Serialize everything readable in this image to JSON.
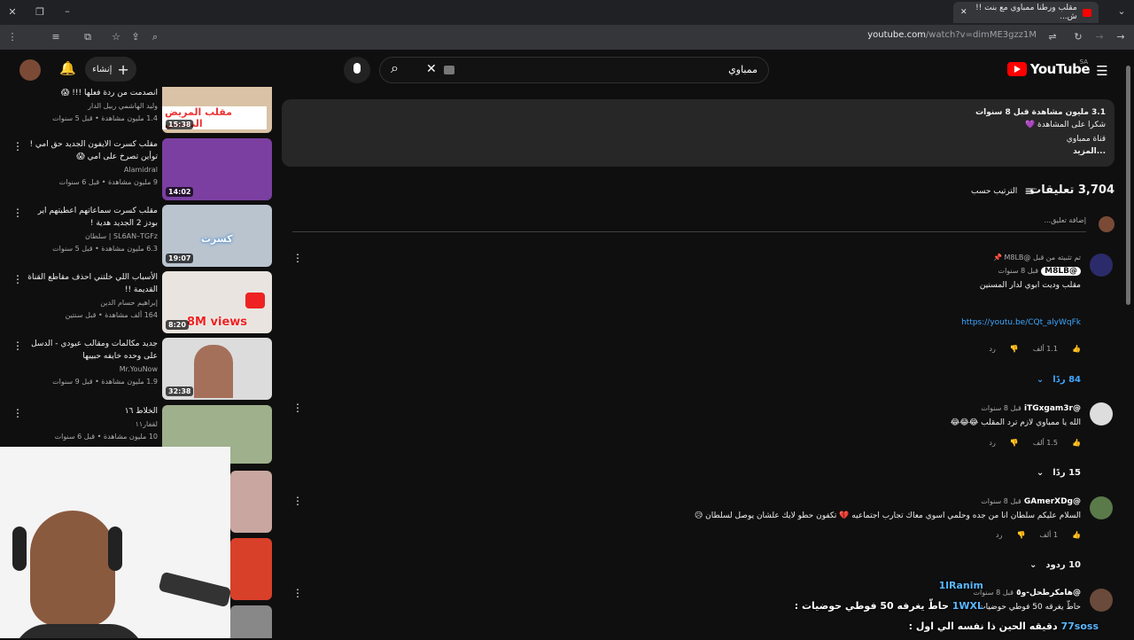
{
  "browser": {
    "tab_title": "مقلب ورطنا ممباوي مع بنت !! ش...",
    "url_host": "youtube.com",
    "url_path": "/watch?v=dimME3gzz1M"
  },
  "header": {
    "logo_text": "YouTube",
    "region": "SA",
    "search_query": "ممباوي",
    "create_label": "إنشاء"
  },
  "sidebar_videos": [
    {
      "title": "انصدمت من ردة فعلها !!! 😱",
      "channel": "وليد الهاشمي ربيل الدار",
      "meta": "1.4 مليون مشاهدة • قبل 5 سنوات",
      "duration": "15:38",
      "thumb_text": "مقلب المريض النفسي",
      "thumb_color": "#d9c2a5"
    },
    {
      "title": "مقلب كسرت الايفون الجديد حق امي ! توأين تصرخ على امي 😱",
      "channel": "Alamidral",
      "meta": "9 مليون مشاهدة • قبل 6 سنوات",
      "duration": "14:02",
      "thumb_text": "",
      "thumb_color": "#7a3fa0"
    },
    {
      "title": "مقلب كسرت سماعاتهم اعطيتهم اير بودز 2 الجديد هدية !",
      "channel": "SL6AN–TGFz | سلطان",
      "meta": "6.3 مليون مشاهدة • قبل 5 سنوات",
      "duration": "19:07",
      "thumb_text": "كسرت",
      "thumb_color": "#b9c4cf"
    },
    {
      "title": "الأسباب اللي خلتني احذف مقاطع القناة القديمة !!",
      "channel": "إبراهيم حسام الدين",
      "meta": "164 ألف مشاهدة • قبل سنتين",
      "duration": "8:20",
      "thumb_text": "8M views",
      "thumb_color": "#e9e4df"
    },
    {
      "title": "جديد مكالمات ومقالب عبودي - الدسل على وحده خايفه حبيبها",
      "channel": "Mr.YouNow",
      "meta": "1.9 مليون مشاهدة • قبل 9 سنوات",
      "duration": "32:38",
      "thumb_text": "",
      "thumb_color": "#dcdcdc"
    },
    {
      "title": "الخلاط ١٦",
      "channel": "لقفار١١",
      "meta": "10 مليون مشاهدة • قبل 6 سنوات",
      "duration": "",
      "thumb_text": "",
      "thumb_color": "#9fb08c"
    }
  ],
  "description": {
    "stats": "3.1 مليون مشاهدة  قبل 8 سنوات",
    "line1": "شكرا على المشاهدة 💜",
    "line2": "قناة ممباوي",
    "more": "...المزيد"
  },
  "comments_header": {
    "count": "3,704 تعليقات",
    "sort_label": "الترتيب حسب",
    "add_placeholder": "إضافة تعليق..."
  },
  "comments": [
    {
      "pinned_note": "تم تثبيته من قبل @M8LB",
      "author": "@M8LB",
      "time": "قبل 8 سنوات",
      "text": "مقلب وديت ابوي لدار المسنين",
      "link": "https://youtu.be/CQt_alyWqFk",
      "likes": "1.1 ألف",
      "reply_label": "رد",
      "replies": "84 ردًا"
    },
    {
      "author": "@iTGxgam3r",
      "time": "قبل 8 سنوات",
      "text": "الله يا ممباوي لازم ترد المقلب 😂😂😂",
      "likes": "1.5 ألف",
      "reply_label": "رد",
      "replies": "15 ردًا"
    },
    {
      "author": "@GAmerXDg",
      "time": "قبل 8 سنوات",
      "text": "السلام عليكم سلطان انا من جده وحلمي اسوي معاك تجارب اجتماعيه 💔 تكفون حطو لايك علشان يوصل لسلطان 😥",
      "likes": "1 ألف",
      "reply_label": "رد",
      "replies": "10 ردود"
    },
    {
      "author": "@هامكرطحل-و٥",
      "time": "قبل 8 سنوات",
      "text": "حاطّ يغرقه 50 فوطي حوضيات"
    }
  ],
  "chat_overlay": [
    {
      "name": "1lRanim",
      "text": ""
    },
    {
      "name": "1WXL",
      "text": "حاطّ يغرفه 50 فوطي حوضيات :"
    },
    {
      "name": "77soss",
      "text": "دقيقه الحين ذا نفسه الي اول :"
    }
  ],
  "colors": {
    "background": "#0f0f0f",
    "accent_red": "#ff0000",
    "link_blue": "#3ea6ff"
  }
}
